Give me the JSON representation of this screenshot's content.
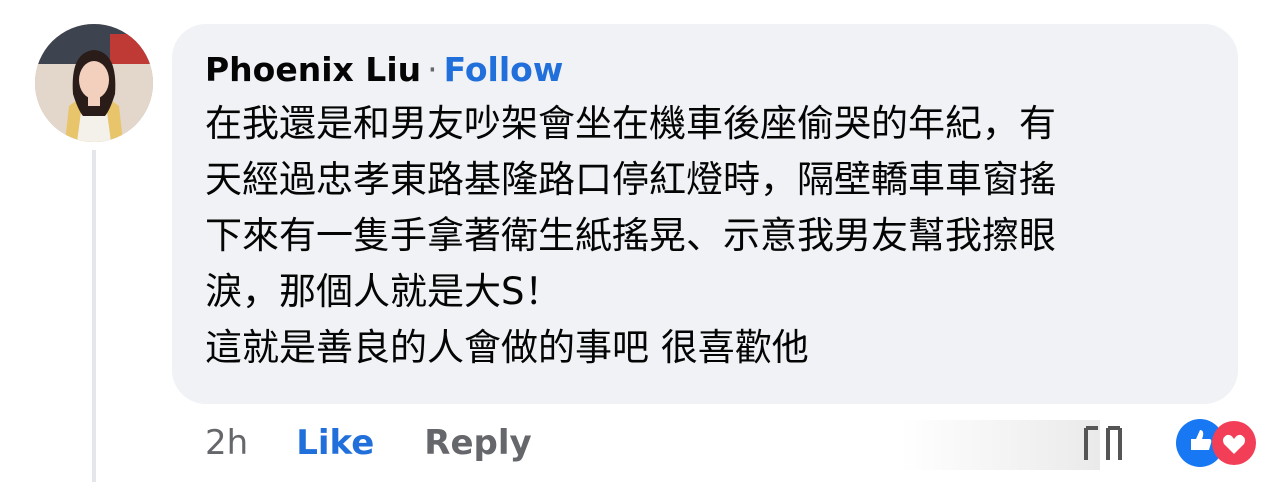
{
  "comment": {
    "author": "Phoenix Liu",
    "separator": "·",
    "follow_label": "Follow",
    "body_lines": [
      "在我還是和男友吵架會坐在機車後座偷哭的年紀，有",
      "天經過忠孝東路基隆路口停紅燈時，隔壁轎車車窗搖",
      "下來有一隻手拿著衛生紙搖晃、示意我男友幫我擦眼",
      "淚，那個人就是大S！",
      "這就是善良的人會做的事吧 很喜歡他"
    ],
    "timestamp": "2h",
    "like_label": "Like",
    "reply_label": "Reply",
    "reactions": [
      "like-icon",
      "love-icon"
    ]
  },
  "colors": {
    "bubble": "#f0f2f5",
    "accent": "#216fdb",
    "muted": "#65676b",
    "text": "#050505"
  }
}
